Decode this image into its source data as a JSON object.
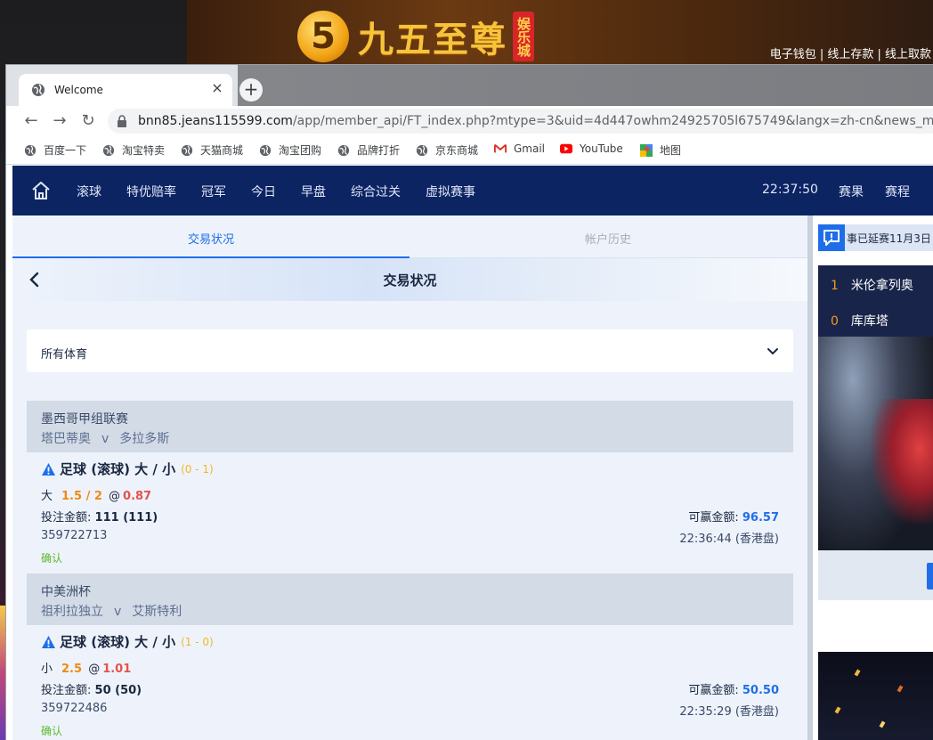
{
  "background_site": {
    "logo_number": "5",
    "logo_text": "九五至尊",
    "logo_tag": "娱乐城",
    "links": "电子钱包 | 线上存款 | 线上取款"
  },
  "browser": {
    "tab_title": "Welcome",
    "tab_close": "×",
    "new_tab": "+",
    "back": "←",
    "forward": "→",
    "reload": "↻",
    "url_host": "bnn85.jeans115599.com",
    "url_path": "/app/member_api/FT_index.php?mtype=3&uid=4d447owhm24925705l675749&langx=zh-cn&news_mem=Y",
    "bookmarks": [
      {
        "label": "百度一下",
        "icon": "globe-icon"
      },
      {
        "label": "淘宝特卖",
        "icon": "globe-icon"
      },
      {
        "label": "天猫商城",
        "icon": "globe-icon"
      },
      {
        "label": "淘宝团购",
        "icon": "globe-icon"
      },
      {
        "label": "品牌打折",
        "icon": "globe-icon"
      },
      {
        "label": "京东商城",
        "icon": "globe-icon"
      },
      {
        "label": "Gmail",
        "icon": "gmail-icon"
      },
      {
        "label": "YouTube",
        "icon": "youtube-icon"
      },
      {
        "label": "地图",
        "icon": "maps-icon"
      }
    ]
  },
  "topnav": {
    "items": [
      "滚球",
      "特优赔率",
      "冠军",
      "今日",
      "早盘",
      "综合过关",
      "虚拟赛事"
    ],
    "clock": "22:37:50",
    "right_items": [
      "赛果",
      "赛程"
    ]
  },
  "main": {
    "tabs": [
      "交易状况",
      "帐户历史"
    ],
    "title": "交易状况",
    "filter": "所有体育",
    "bets": [
      {
        "league": "墨西哥甲组联赛",
        "home": "塔巴蒂奥",
        "vs": "v",
        "away": "多拉多斯",
        "type": "足球 (滚球) 大 / 小",
        "score": "(0 - 1)",
        "side": "大",
        "line": "1.5 / 2",
        "at": "@",
        "odds": "0.87",
        "stake_label": "投注金额:",
        "stake": "111 (111)",
        "win_label": "可赢金额:",
        "win": "96.57",
        "ticket": "359722713",
        "time": "22:36:44 (香港盘)",
        "status": "确认"
      },
      {
        "league": "中美洲杯",
        "home": "祖利拉独立",
        "vs": "v",
        "away": "艾斯特利",
        "type": "足球 (滚球) 大 / 小",
        "score": "(1 - 0)",
        "side": "小",
        "line": "2.5",
        "at": "@",
        "odds": "1.01",
        "stake_label": "投注金额:",
        "stake": "50 (50)",
        "win_label": "可赢金额:",
        "win": "50.50",
        "ticket": "359722486",
        "time": "22:35:29 (香港盘)",
        "status": "确认"
      }
    ]
  },
  "side": {
    "marquee": "事已延赛11月3日",
    "scores": [
      {
        "num": "1",
        "team": "米伦拿列奥"
      },
      {
        "num": "0",
        "team": "库库塔"
      }
    ]
  },
  "colors": {
    "nav_bg": "#0d2463",
    "accent": "#1f6ee8",
    "line_orange": "#ee8a13",
    "odds_red": "#e5534b",
    "score_yellow": "#f1b62a",
    "confirm_green": "#5cb82d"
  }
}
